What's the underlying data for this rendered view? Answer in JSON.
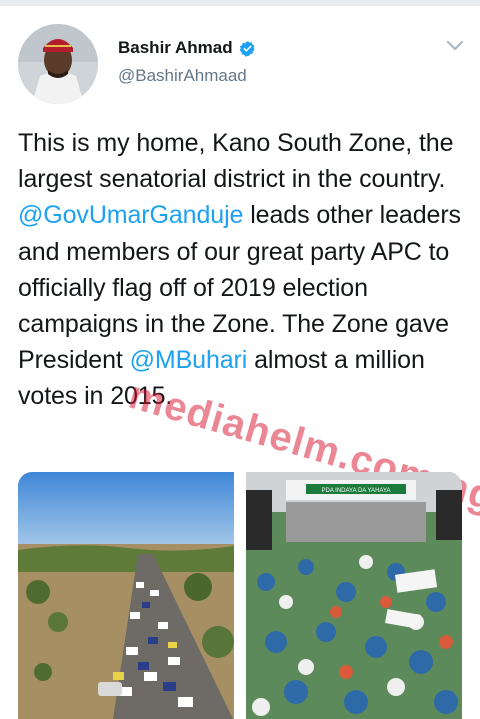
{
  "tweet": {
    "author": {
      "display_name": "Bashir Ahmad",
      "handle": "@BashirAhmaad",
      "verified": true
    },
    "text_parts": [
      "This is my home, Kano South Zone, the largest senatorial district in the country. ",
      "@GovUmarGanduje",
      " leads other leaders and members of our great party APC to officially flag off of 2019 election campaigns in the Zone. The Zone gave President ",
      "@MBuhari",
      " almost a million votes in 2015."
    ],
    "menu_icon": "chevron-down-icon"
  },
  "watermark": "mediahelm.com.ng",
  "media": [
    {
      "name": "road-convoy-photo",
      "description_icon": "photo"
    },
    {
      "name": "rally-crowd-photo",
      "banner_text": "PDA INDAYA DA YAHAYA"
    }
  ],
  "colors": {
    "accent": "#1da1f2",
    "text": "#14171a",
    "secondary": "#657786",
    "watermark": "#d8112e"
  }
}
